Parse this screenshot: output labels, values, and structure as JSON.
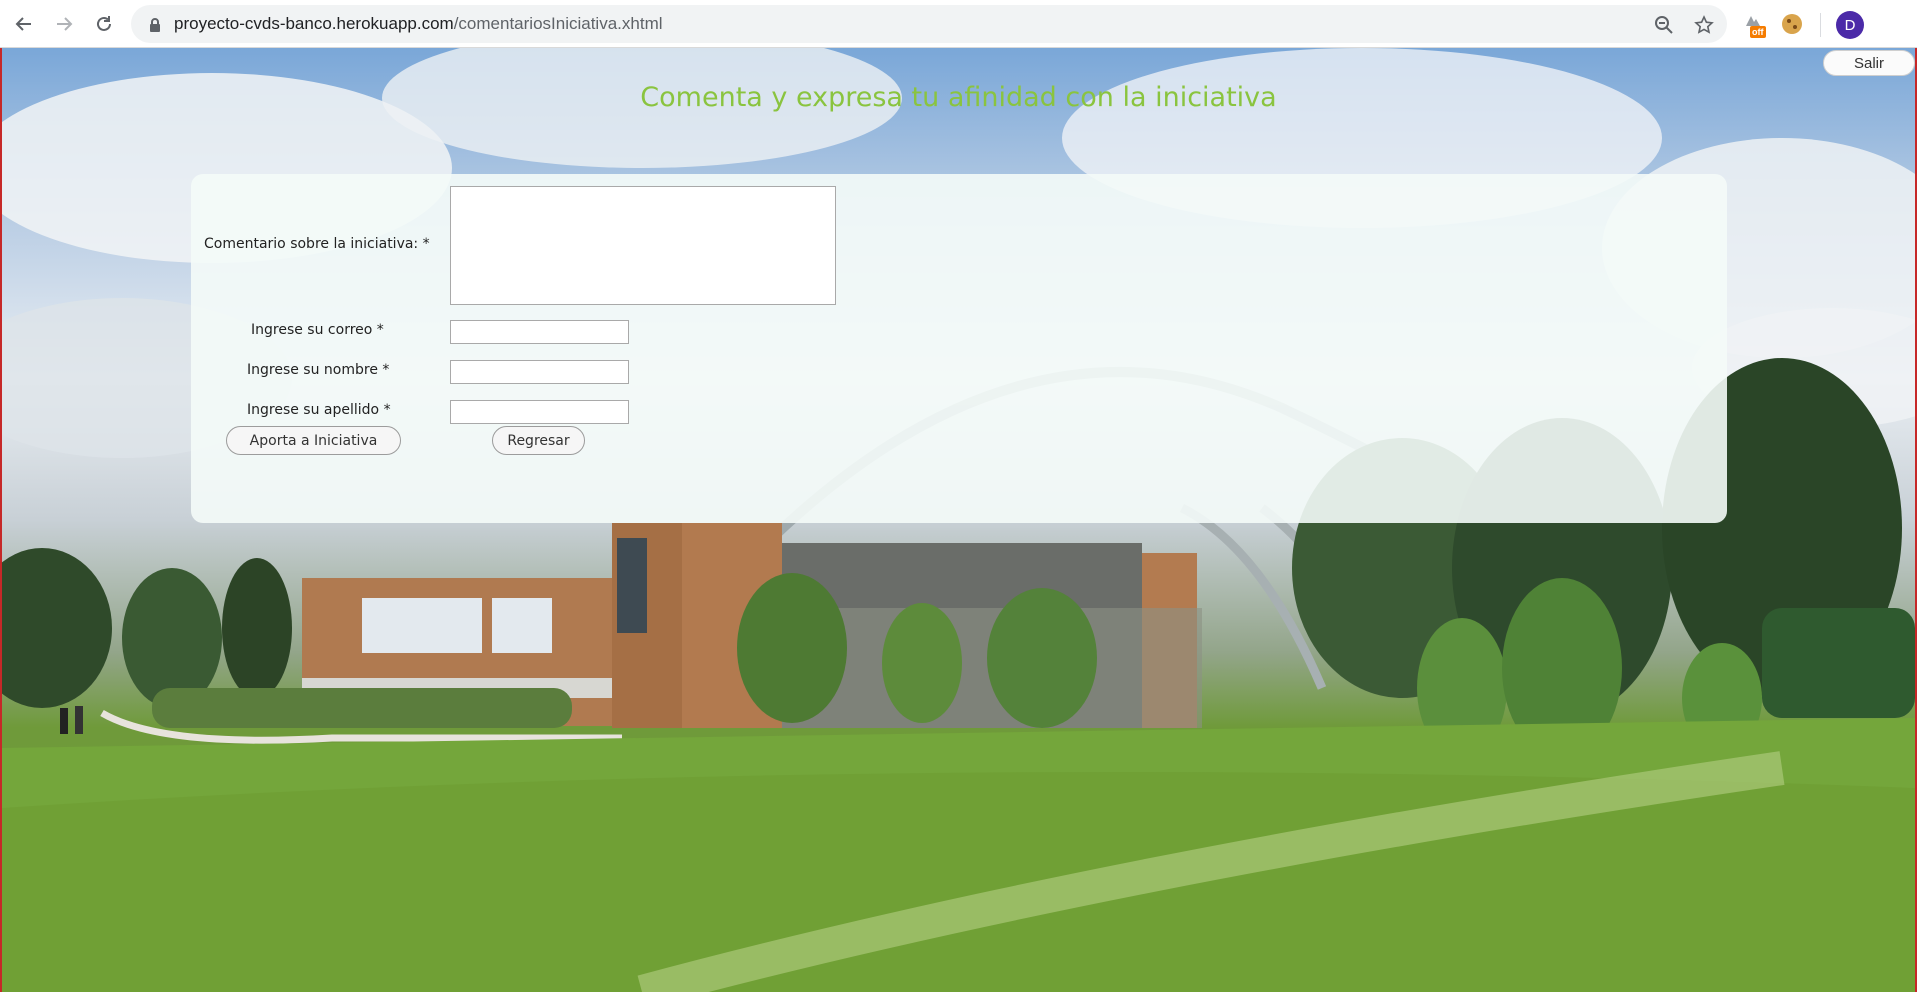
{
  "browser": {
    "url_domain": "proyecto-cvds-banco.herokuapp.com",
    "url_path": "/comentariosIniciativa.xhtml",
    "extension_badge": "off",
    "profile_initial": "D"
  },
  "page": {
    "title": "Comenta y expresa tu afinidad con la iniciativa",
    "logout_label": "Salir",
    "title_color": "#8ac43f"
  },
  "form": {
    "comment_label": "Comentario sobre la iniciativa: *",
    "comment_value": "",
    "email_label": "Ingrese su correo *",
    "email_value": "",
    "name_label": "Ingrese su nombre *",
    "name_value": "",
    "lastname_label": "Ingrese su apellido *",
    "lastname_value": "",
    "submit_label": "Aporta a Iniciativa",
    "back_label": "Regresar"
  }
}
